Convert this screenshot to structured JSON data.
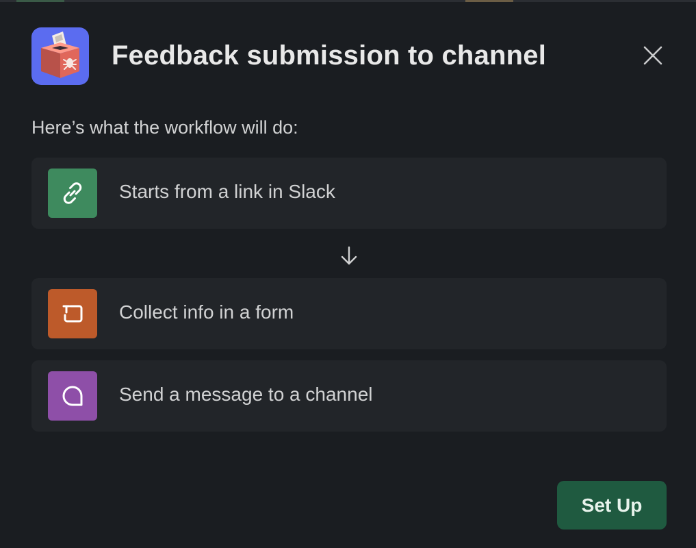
{
  "modal": {
    "title": "Feedback submission to channel",
    "subtitle": "Here’s what the workflow will do:",
    "close_icon": "close-icon",
    "app_icon": "feedback-box-icon"
  },
  "steps": [
    {
      "label": "Starts from a link in Slack",
      "icon": "link-icon",
      "color": "#3e8a5e"
    },
    {
      "label": "Collect info in a form",
      "icon": "form-icon",
      "color": "#bd5a2a"
    },
    {
      "label": "Send a message to a channel",
      "icon": "message-bubble-icon",
      "color": "#8e4fa8"
    }
  ],
  "connector_icon": "arrow-down-icon",
  "footer": {
    "setup_label": "Set Up",
    "setup_color": "#1f5a40"
  }
}
